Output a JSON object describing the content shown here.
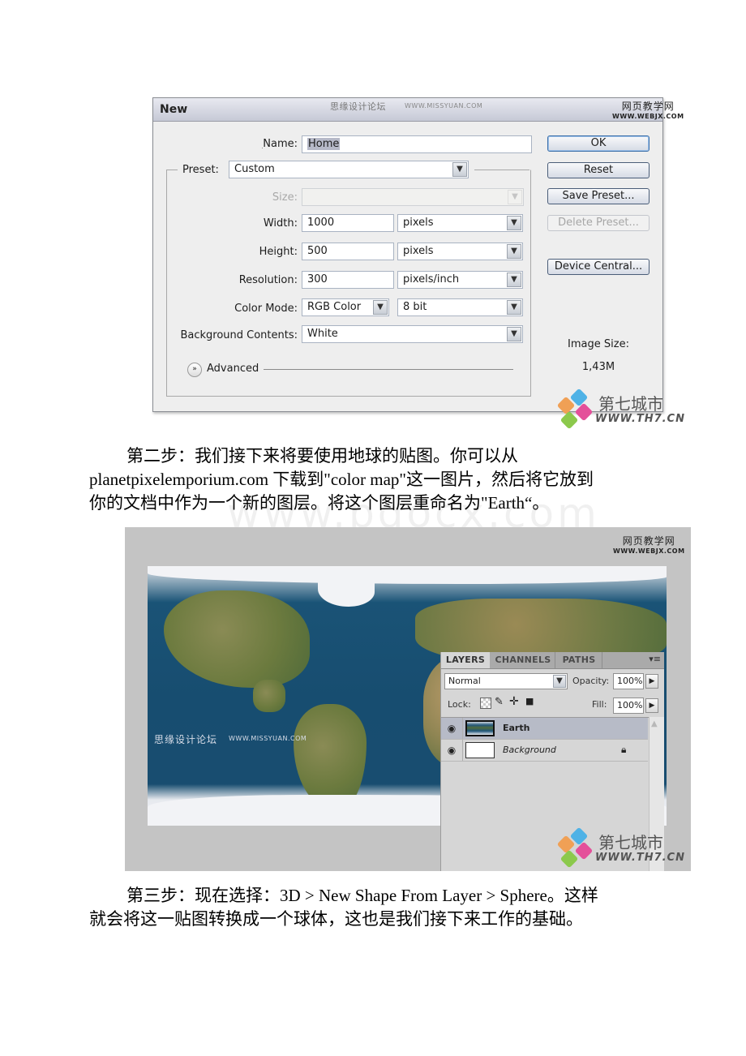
{
  "dialog": {
    "title": "New",
    "watermark_top": "思缘设计论坛",
    "watermark_top_url": "WWW.MISSYUAN.COM",
    "watermark_corner_cn": "网页教学网",
    "watermark_corner_url": "WWW.WEBJX.COM",
    "name_label": "Name:",
    "name_value": "Home",
    "preset_label": "Preset:",
    "preset_value": "Custom",
    "size_label": "Size:",
    "size_value": "",
    "width_label": "Width:",
    "width_value": "1000",
    "width_unit": "pixels",
    "height_label": "Height:",
    "height_value": "500",
    "height_unit": "pixels",
    "resolution_label": "Resolution:",
    "resolution_value": "300",
    "resolution_unit": "pixels/inch",
    "color_mode_label": "Color Mode:",
    "color_mode_value": "RGB Color",
    "bit_depth_value": "8 bit",
    "bg_contents_label": "Background Contents:",
    "bg_contents_value": "White",
    "advanced_label": "Advanced",
    "buttons": {
      "ok": "OK",
      "reset": "Reset",
      "save_preset": "Save Preset...",
      "delete_preset": "Delete Preset...",
      "device_central": "Device Central..."
    },
    "image_size_label": "Image Size:",
    "image_size_value": "1,43M"
  },
  "logo_watermark": {
    "cn": "第七城市",
    "url": "WWW.TH7.CN"
  },
  "paragraphs": {
    "step2_line1": "第二步：我们接下来将要使用地球的贴图。你可以从",
    "step2_line2": "planetpixelemporium.com 下载到\"color map\"这一图片，然后将它放到",
    "step2_line3": "你的文档中作为一个新的图层。将这个图层重命名为\"Earth“。",
    "step3_line1": "第三步：现在选择：3D > New Shape From Layer > Sphere。这样",
    "step3_line2": "就会将这一贴图转换成一个球体，这也是我们接下来工作的基础。",
    "bg_watermark": "www.bdocx.com"
  },
  "earth_shot": {
    "watermark_corner_cn": "网页教学网",
    "watermark_corner_url": "WWW.WEBJX.COM",
    "watermark_mid": "思缘设计论坛",
    "watermark_mid_url": "WWW.MISSYUAN.COM",
    "layers_panel": {
      "tabs": [
        "LAYERS",
        "CHANNELS",
        "PATHS"
      ],
      "blend_mode": "Normal",
      "opacity_label": "Opacity:",
      "opacity_value": "100%",
      "lock_label": "Lock:",
      "fill_label": "Fill:",
      "fill_value": "100%",
      "layers": [
        {
          "name": "Earth",
          "selected": true,
          "visible": true
        },
        {
          "name": "Background",
          "selected": false,
          "visible": true,
          "locked": true
        }
      ]
    }
  }
}
